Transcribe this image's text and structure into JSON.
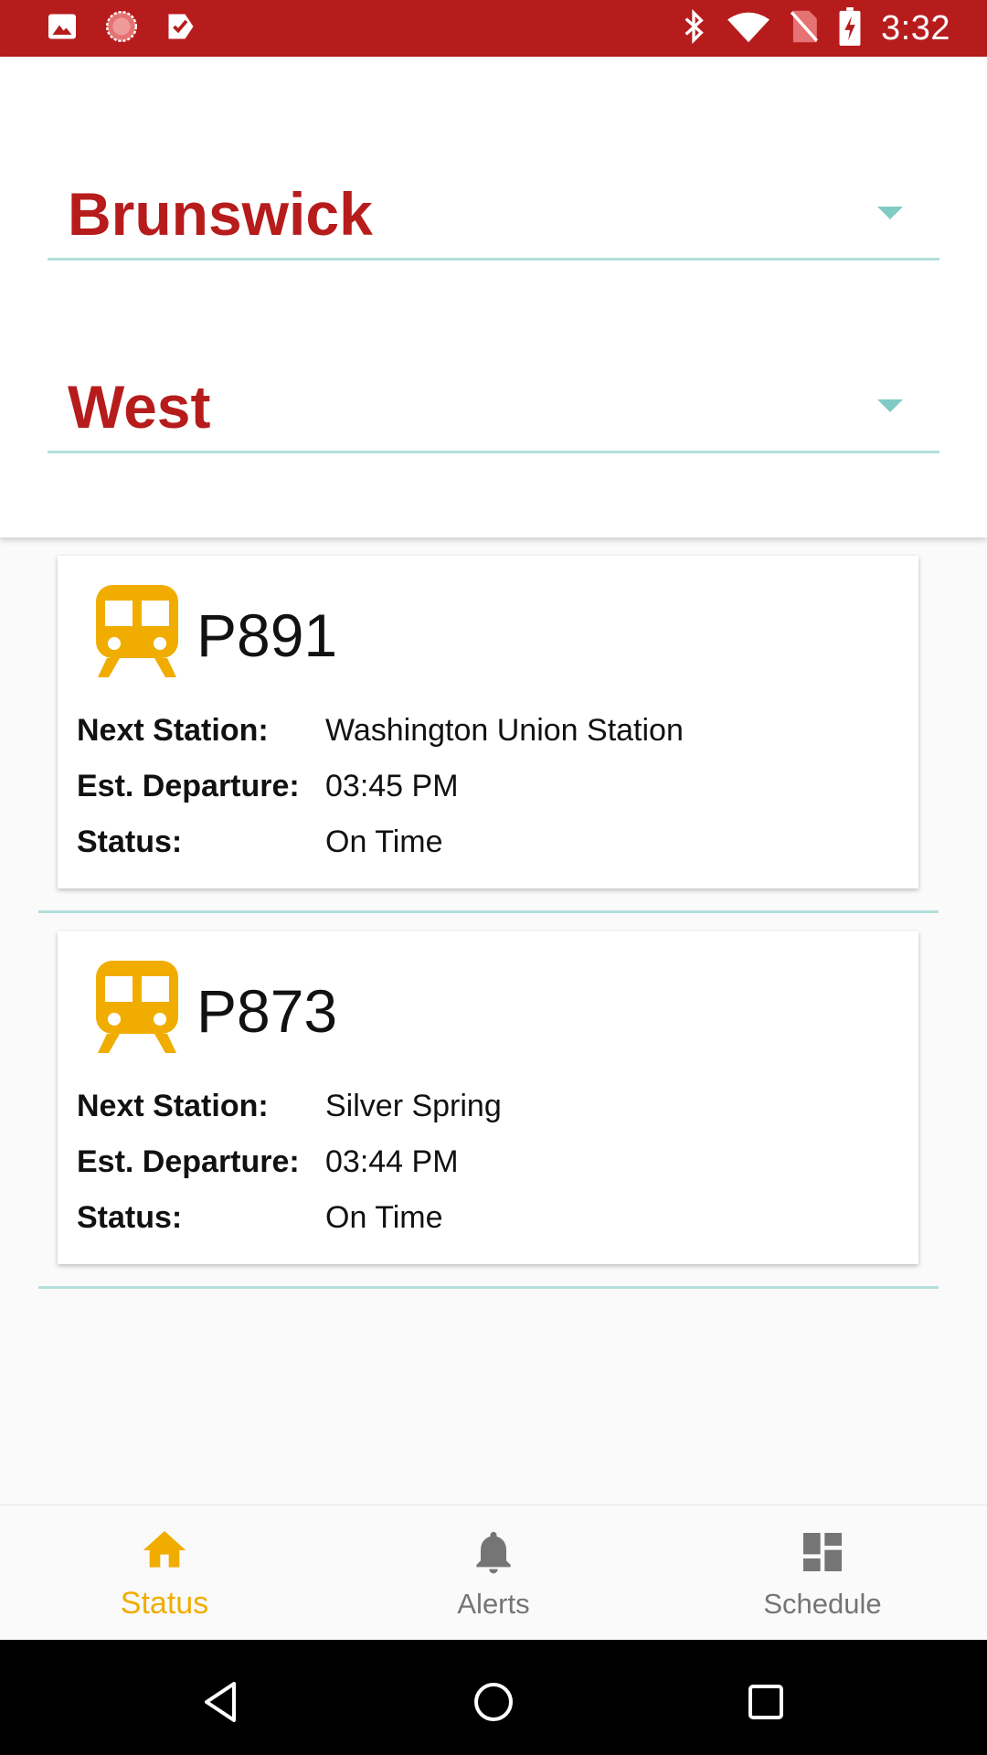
{
  "status_bar": {
    "time": "3:32",
    "left_icons": [
      "image-icon",
      "sync-progress-icon",
      "task-check-icon"
    ],
    "right_icons": [
      "bluetooth-icon",
      "wifi-icon",
      "no-sim-icon",
      "battery-charging-icon"
    ]
  },
  "selectors": {
    "station": {
      "value": "Brunswick"
    },
    "direction": {
      "value": "West"
    }
  },
  "trains": [
    {
      "number": "P891",
      "icon": "train-icon",
      "next_station_label": "Next Station:",
      "next_station": "Washington Union Station",
      "departure_label": "Est. Departure:",
      "departure": "03:45 PM",
      "status_label": "Status:",
      "status": "On Time"
    },
    {
      "number": "P873",
      "icon": "train-icon",
      "next_station_label": "Next Station:",
      "next_station": "Silver Spring",
      "departure_label": "Est. Departure:",
      "departure": "03:44 PM",
      "status_label": "Status:",
      "status": "On Time"
    }
  ],
  "bottom_nav": {
    "items": [
      {
        "label": "Status",
        "icon": "home-icon",
        "active": true
      },
      {
        "label": "Alerts",
        "icon": "bell-icon",
        "active": false
      },
      {
        "label": "Schedule",
        "icon": "dashboard-icon",
        "active": false
      }
    ]
  },
  "colors": {
    "status_bar": "#b71c1c",
    "accent_red": "#b71c1c",
    "train_icon": "#f0ad00",
    "active_nav": "#f0ad00",
    "inactive_nav": "#757575",
    "underline": "#b2dfdb"
  }
}
